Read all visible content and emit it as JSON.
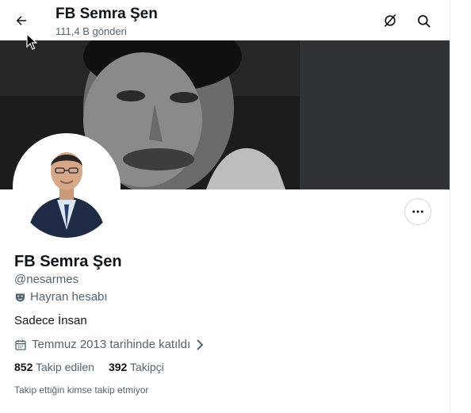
{
  "header": {
    "name": "FB Semra Şen",
    "post_count": "111,4 B gönderi"
  },
  "profile": {
    "display_name": "FB Semra Şen",
    "handle": "@nesarmes",
    "fan_label": "Hayran hesabı",
    "bio": "Sadece İnsan",
    "joined": "Temmuz 2013 tarihinde katıldı",
    "following_count": "852",
    "following_label": "Takip edilen",
    "followers_count": "392",
    "followers_label": "Takipçi",
    "mutual_note": "Takip ettiğin kimse takip etmiyor"
  },
  "icons": {
    "back": "back-arrow-icon",
    "grok": "grok-icon",
    "search": "search-icon",
    "more": "more-icon",
    "fan": "theater-mask-icon",
    "calendar": "calendar-icon",
    "chevron": "chevron-right-icon"
  },
  "colors": {
    "text_primary": "#0f1419",
    "text_secondary": "#536471",
    "border": "#cfd9de"
  }
}
